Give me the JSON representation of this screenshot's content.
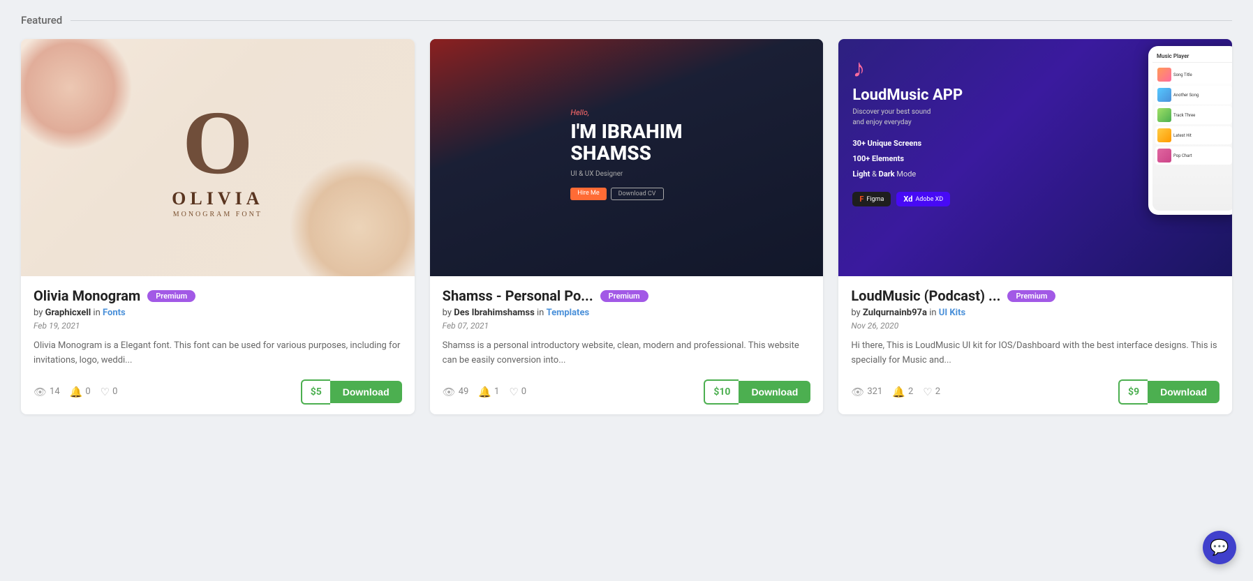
{
  "section": {
    "title": "Featured"
  },
  "cards": [
    {
      "id": "olivia",
      "title": "Olivia Monogram",
      "badge": "Premium",
      "author_label": "by",
      "author_name": "Graphicxell",
      "category_prefix": "in",
      "category": "Fonts",
      "date": "Feb 19, 2021",
      "description": "Olivia Monogram is a Elegant font. This font can be used for various purposes, including for invitations, logo, weddi...",
      "stats": {
        "views": "14",
        "comments": "0",
        "likes": "0"
      },
      "price": "$5",
      "download_label": "Download",
      "monogram_letter": "O",
      "monogram_name": "OLIVIA",
      "monogram_sub": "MONOGRAM FONT"
    },
    {
      "id": "shamss",
      "title": "Shamss - Personal Po...",
      "badge": "Premium",
      "author_label": "by",
      "author_name": "Des Ibrahimshamss",
      "category_prefix": "in",
      "category": "Templates",
      "date": "Feb 07, 2021",
      "description": "Shamss is a personal introductory website, clean, modern and professional. This website can be easily conversion into...",
      "stats": {
        "views": "49",
        "comments": "1",
        "likes": "0"
      },
      "price": "$10",
      "download_label": "Download",
      "shamss_hello": "Hello,",
      "shamss_name": "I'M IBRAHIM\nSHAMSS",
      "shamss_role": "UI & UX Designer",
      "shamss_btn1": "Hire Me",
      "shamss_btn2": "Download CV"
    },
    {
      "id": "loudmusic",
      "title": "LoudMusic (Podcast) ...",
      "badge": "Premium",
      "author_label": "by",
      "author_name": "Zulqurnainb97a",
      "category_prefix": "in",
      "category": "UI Kits",
      "date": "Nov 26, 2020",
      "description": "Hi there, This is LoudMusic UI kit for IOS/Dashboard with the best interface designs. This is specially for Music and...",
      "stats": {
        "views": "321",
        "comments": "2",
        "likes": "2"
      },
      "price": "$9",
      "download_label": "Download",
      "loud_title": "LoudMusic APP",
      "loud_subtitle": "Discover your best sound\nand enjoy everyday",
      "loud_feat1": "30+ Unique Screens",
      "loud_feat2": "100+ Elements",
      "loud_feat3_bold": "Light",
      "loud_feat3_mid": " & ",
      "loud_feat3_bold2": "Dark",
      "loud_feat3_end": " Mode",
      "badge_figma": "Figma",
      "badge_xd": "Adobe XD",
      "phone_header": "Music Player"
    }
  ],
  "chat": {
    "icon": "💬"
  }
}
